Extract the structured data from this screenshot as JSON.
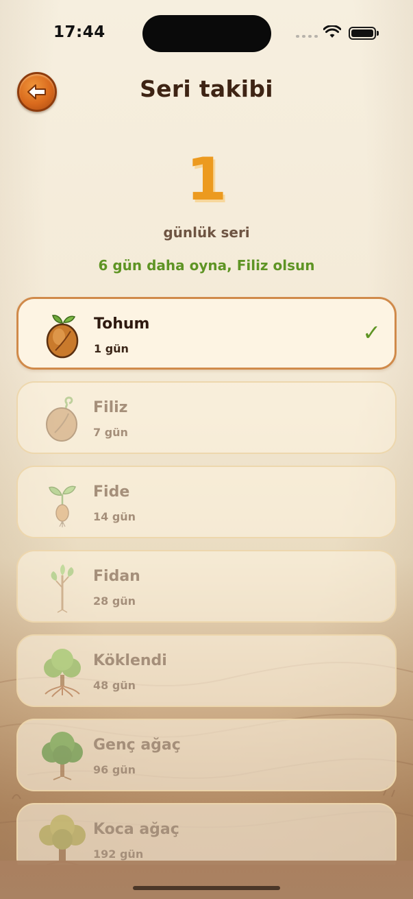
{
  "status_bar": {
    "time": "17:44"
  },
  "header": {
    "back_icon": "arrow-left-icon",
    "title": "Seri takibi"
  },
  "streak": {
    "count": "1",
    "label": "günlük seri",
    "hint": "6 gün daha oyna, Filiz olsun"
  },
  "colors": {
    "accent_orange": "#ec9a1f",
    "hint_green": "#5e9424",
    "active_border": "#d08a4a",
    "back_button": "#d96a1d"
  },
  "stages": [
    {
      "name": "Tohum",
      "days": "1 gün",
      "icon": "seed-icon",
      "completed": true
    },
    {
      "name": "Filiz",
      "days": "7 gün",
      "icon": "sprout-seed-icon",
      "completed": false
    },
    {
      "name": "Fide",
      "days": "14 gün",
      "icon": "seedling-icon",
      "completed": false
    },
    {
      "name": "Fidan",
      "days": "28 gün",
      "icon": "sapling-icon",
      "completed": false
    },
    {
      "name": "Köklendi",
      "days": "48 gün",
      "icon": "rooted-tree-icon",
      "completed": false
    },
    {
      "name": "Genç ağaç",
      "days": "96 gün",
      "icon": "young-tree-icon",
      "completed": false
    },
    {
      "name": "Koca ağaç",
      "days": "192 gün",
      "icon": "big-tree-icon",
      "completed": false
    }
  ],
  "check_mark": "✓"
}
